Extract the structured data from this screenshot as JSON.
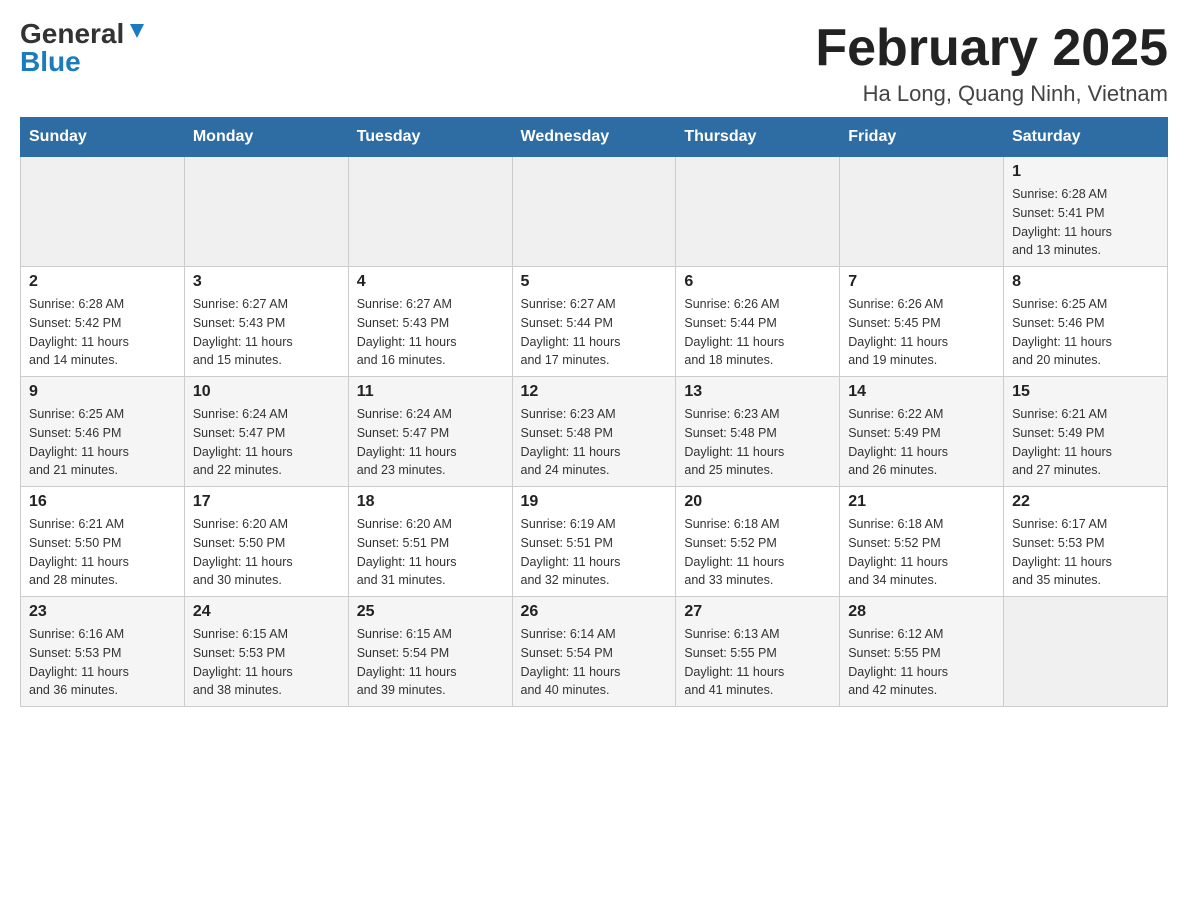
{
  "header": {
    "logo_general": "General",
    "logo_blue": "Blue",
    "month_title": "February 2025",
    "location": "Ha Long, Quang Ninh, Vietnam"
  },
  "weekdays": [
    "Sunday",
    "Monday",
    "Tuesday",
    "Wednesday",
    "Thursday",
    "Friday",
    "Saturday"
  ],
  "weeks": [
    {
      "days": [
        {
          "num": "",
          "info": ""
        },
        {
          "num": "",
          "info": ""
        },
        {
          "num": "",
          "info": ""
        },
        {
          "num": "",
          "info": ""
        },
        {
          "num": "",
          "info": ""
        },
        {
          "num": "",
          "info": ""
        },
        {
          "num": "1",
          "info": "Sunrise: 6:28 AM\nSunset: 5:41 PM\nDaylight: 11 hours\nand 13 minutes."
        }
      ]
    },
    {
      "days": [
        {
          "num": "2",
          "info": "Sunrise: 6:28 AM\nSunset: 5:42 PM\nDaylight: 11 hours\nand 14 minutes."
        },
        {
          "num": "3",
          "info": "Sunrise: 6:27 AM\nSunset: 5:43 PM\nDaylight: 11 hours\nand 15 minutes."
        },
        {
          "num": "4",
          "info": "Sunrise: 6:27 AM\nSunset: 5:43 PM\nDaylight: 11 hours\nand 16 minutes."
        },
        {
          "num": "5",
          "info": "Sunrise: 6:27 AM\nSunset: 5:44 PM\nDaylight: 11 hours\nand 17 minutes."
        },
        {
          "num": "6",
          "info": "Sunrise: 6:26 AM\nSunset: 5:44 PM\nDaylight: 11 hours\nand 18 minutes."
        },
        {
          "num": "7",
          "info": "Sunrise: 6:26 AM\nSunset: 5:45 PM\nDaylight: 11 hours\nand 19 minutes."
        },
        {
          "num": "8",
          "info": "Sunrise: 6:25 AM\nSunset: 5:46 PM\nDaylight: 11 hours\nand 20 minutes."
        }
      ]
    },
    {
      "days": [
        {
          "num": "9",
          "info": "Sunrise: 6:25 AM\nSunset: 5:46 PM\nDaylight: 11 hours\nand 21 minutes."
        },
        {
          "num": "10",
          "info": "Sunrise: 6:24 AM\nSunset: 5:47 PM\nDaylight: 11 hours\nand 22 minutes."
        },
        {
          "num": "11",
          "info": "Sunrise: 6:24 AM\nSunset: 5:47 PM\nDaylight: 11 hours\nand 23 minutes."
        },
        {
          "num": "12",
          "info": "Sunrise: 6:23 AM\nSunset: 5:48 PM\nDaylight: 11 hours\nand 24 minutes."
        },
        {
          "num": "13",
          "info": "Sunrise: 6:23 AM\nSunset: 5:48 PM\nDaylight: 11 hours\nand 25 minutes."
        },
        {
          "num": "14",
          "info": "Sunrise: 6:22 AM\nSunset: 5:49 PM\nDaylight: 11 hours\nand 26 minutes."
        },
        {
          "num": "15",
          "info": "Sunrise: 6:21 AM\nSunset: 5:49 PM\nDaylight: 11 hours\nand 27 minutes."
        }
      ]
    },
    {
      "days": [
        {
          "num": "16",
          "info": "Sunrise: 6:21 AM\nSunset: 5:50 PM\nDaylight: 11 hours\nand 28 minutes."
        },
        {
          "num": "17",
          "info": "Sunrise: 6:20 AM\nSunset: 5:50 PM\nDaylight: 11 hours\nand 30 minutes."
        },
        {
          "num": "18",
          "info": "Sunrise: 6:20 AM\nSunset: 5:51 PM\nDaylight: 11 hours\nand 31 minutes."
        },
        {
          "num": "19",
          "info": "Sunrise: 6:19 AM\nSunset: 5:51 PM\nDaylight: 11 hours\nand 32 minutes."
        },
        {
          "num": "20",
          "info": "Sunrise: 6:18 AM\nSunset: 5:52 PM\nDaylight: 11 hours\nand 33 minutes."
        },
        {
          "num": "21",
          "info": "Sunrise: 6:18 AM\nSunset: 5:52 PM\nDaylight: 11 hours\nand 34 minutes."
        },
        {
          "num": "22",
          "info": "Sunrise: 6:17 AM\nSunset: 5:53 PM\nDaylight: 11 hours\nand 35 minutes."
        }
      ]
    },
    {
      "days": [
        {
          "num": "23",
          "info": "Sunrise: 6:16 AM\nSunset: 5:53 PM\nDaylight: 11 hours\nand 36 minutes."
        },
        {
          "num": "24",
          "info": "Sunrise: 6:15 AM\nSunset: 5:53 PM\nDaylight: 11 hours\nand 38 minutes."
        },
        {
          "num": "25",
          "info": "Sunrise: 6:15 AM\nSunset: 5:54 PM\nDaylight: 11 hours\nand 39 minutes."
        },
        {
          "num": "26",
          "info": "Sunrise: 6:14 AM\nSunset: 5:54 PM\nDaylight: 11 hours\nand 40 minutes."
        },
        {
          "num": "27",
          "info": "Sunrise: 6:13 AM\nSunset: 5:55 PM\nDaylight: 11 hours\nand 41 minutes."
        },
        {
          "num": "28",
          "info": "Sunrise: 6:12 AM\nSunset: 5:55 PM\nDaylight: 11 hours\nand 42 minutes."
        },
        {
          "num": "",
          "info": ""
        }
      ]
    }
  ]
}
